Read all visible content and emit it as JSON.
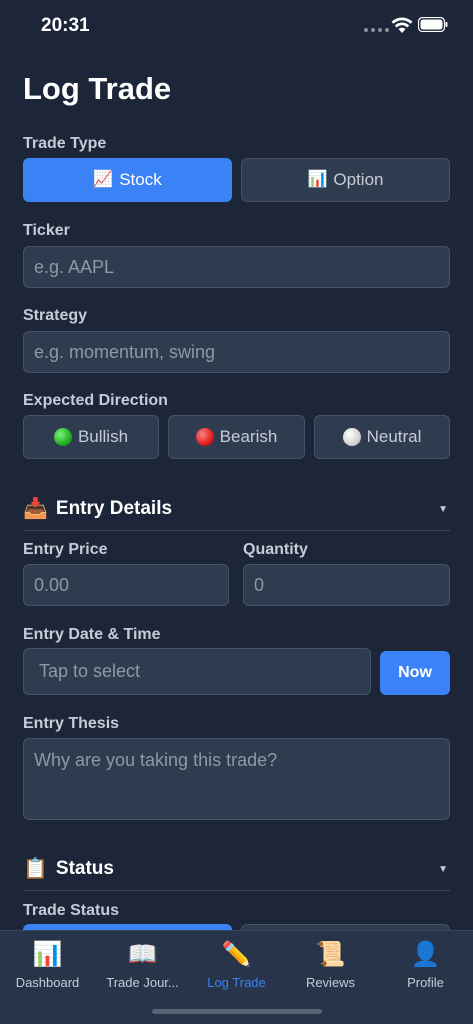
{
  "status_bar": {
    "time": "20:31"
  },
  "page": {
    "title": "Log Trade"
  },
  "trade_type": {
    "label": "Trade Type",
    "options": [
      {
        "emoji": "📈",
        "label": "Stock",
        "selected": true
      },
      {
        "emoji": "📊",
        "label": "Option",
        "selected": false
      }
    ]
  },
  "ticker": {
    "label": "Ticker",
    "placeholder": "e.g. AAPL"
  },
  "strategy": {
    "label": "Strategy",
    "placeholder": "e.g. momentum, swing"
  },
  "direction": {
    "label": "Expected Direction",
    "options": [
      {
        "label": "Bullish",
        "icon": "green-circle-icon"
      },
      {
        "label": "Bearish",
        "icon": "red-circle-icon"
      },
      {
        "label": "Neutral",
        "icon": "white-circle-icon"
      }
    ]
  },
  "entry_section": {
    "emoji": "📥",
    "title": "Entry Details",
    "caret": "▼",
    "price": {
      "label": "Entry Price",
      "placeholder": "0.00"
    },
    "quantity": {
      "label": "Quantity",
      "placeholder": "0"
    },
    "datetime": {
      "label": "Entry Date & Time",
      "placeholder": "Tap to select",
      "now_label": "Now"
    },
    "thesis": {
      "label": "Entry Thesis",
      "placeholder": "Why are you taking this trade?"
    }
  },
  "status_section": {
    "emoji": "📋",
    "title": "Status",
    "caret": "▼",
    "trade_status_label": "Trade Status"
  },
  "tabbar": {
    "active_color": "#3b82f6",
    "items": [
      {
        "emoji": "📊",
        "label": "Dashboard"
      },
      {
        "emoji": "📖",
        "label": "Trade Jour..."
      },
      {
        "emoji": "✏️",
        "label": "Log Trade",
        "active": true
      },
      {
        "emoji": "📜",
        "label": "Reviews"
      },
      {
        "emoji": "👤",
        "label": "Profile"
      }
    ]
  }
}
